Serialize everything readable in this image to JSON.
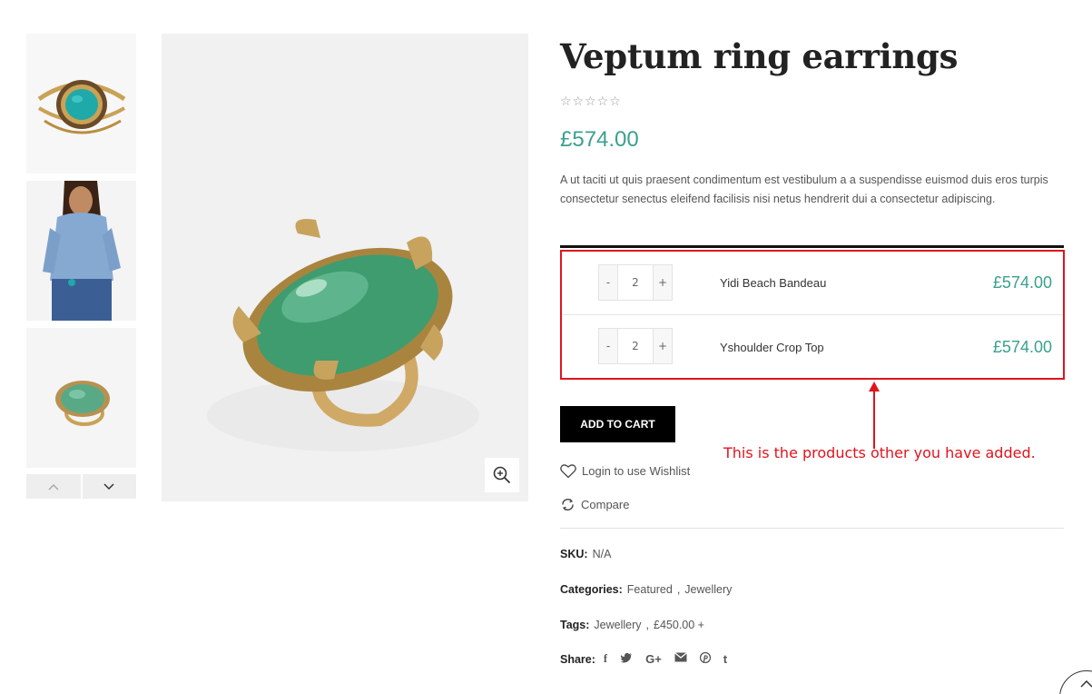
{
  "product": {
    "title": "Veptum ring earrings",
    "rating_stars": "☆☆☆☆☆",
    "price": "£574.00",
    "description": "A ut taciti ut quis praesent condimentum est vestibulum a a suspendisse euismod duis eros turpis consectetur senectus eleifend facilisis nisi netus hendrerit dui a consectetur adipiscing."
  },
  "gallery": {
    "thumbnails": [
      "bracelet-turquoise",
      "model-denim-shirt",
      "green-stone-ring"
    ],
    "main_image": "green-stone-ring",
    "prev_icon": "chevron-up-icon",
    "next_icon": "chevron-down-icon",
    "zoom_icon": "zoom-in-icon"
  },
  "grouped_products": [
    {
      "minus": "-",
      "qty": "2",
      "plus": "+",
      "name": "Yidi Beach Bandeau",
      "price": "£574.00"
    },
    {
      "minus": "-",
      "qty": "2",
      "plus": "+",
      "name": "Yshoulder Crop Top",
      "price": "£574.00"
    }
  ],
  "add_to_cart": "ADD TO CART",
  "annotation": "This is the products other you have added.",
  "wishlist": "Login to use Wishlist",
  "compare": "Compare",
  "meta": {
    "sku_label": "SKU:",
    "sku_value": "N/A",
    "categories_label": "Categories:",
    "categories": [
      "Featured",
      "Jewellery"
    ],
    "tags_label": "Tags:",
    "tags": [
      "Jewellery",
      "£450.00 +"
    ],
    "share_label": "Share:",
    "share_icons": [
      "facebook-icon",
      "twitter-icon",
      "google-plus-icon",
      "email-icon",
      "pinterest-icon",
      "tumblr-icon"
    ]
  },
  "colors": {
    "accent": "#3aa18f",
    "annotation": "#e0141e",
    "button": "#000000"
  }
}
